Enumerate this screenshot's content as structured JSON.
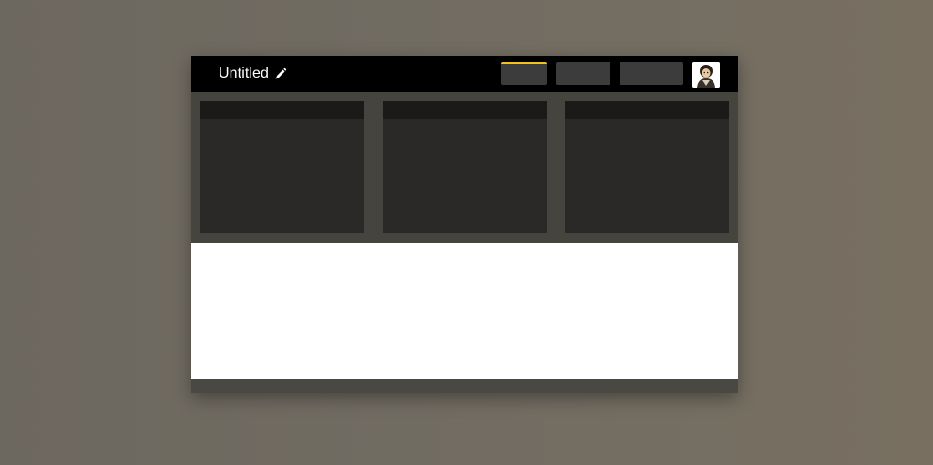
{
  "document": {
    "title": "Untitled"
  },
  "icons": {
    "edit": "pencil-icon",
    "user": "avatar-icon"
  },
  "colors": {
    "active_tab_accent": "#f2c318",
    "topbar": "#000000",
    "panel": "#2b2927",
    "panel_header": "#1b1a18"
  }
}
